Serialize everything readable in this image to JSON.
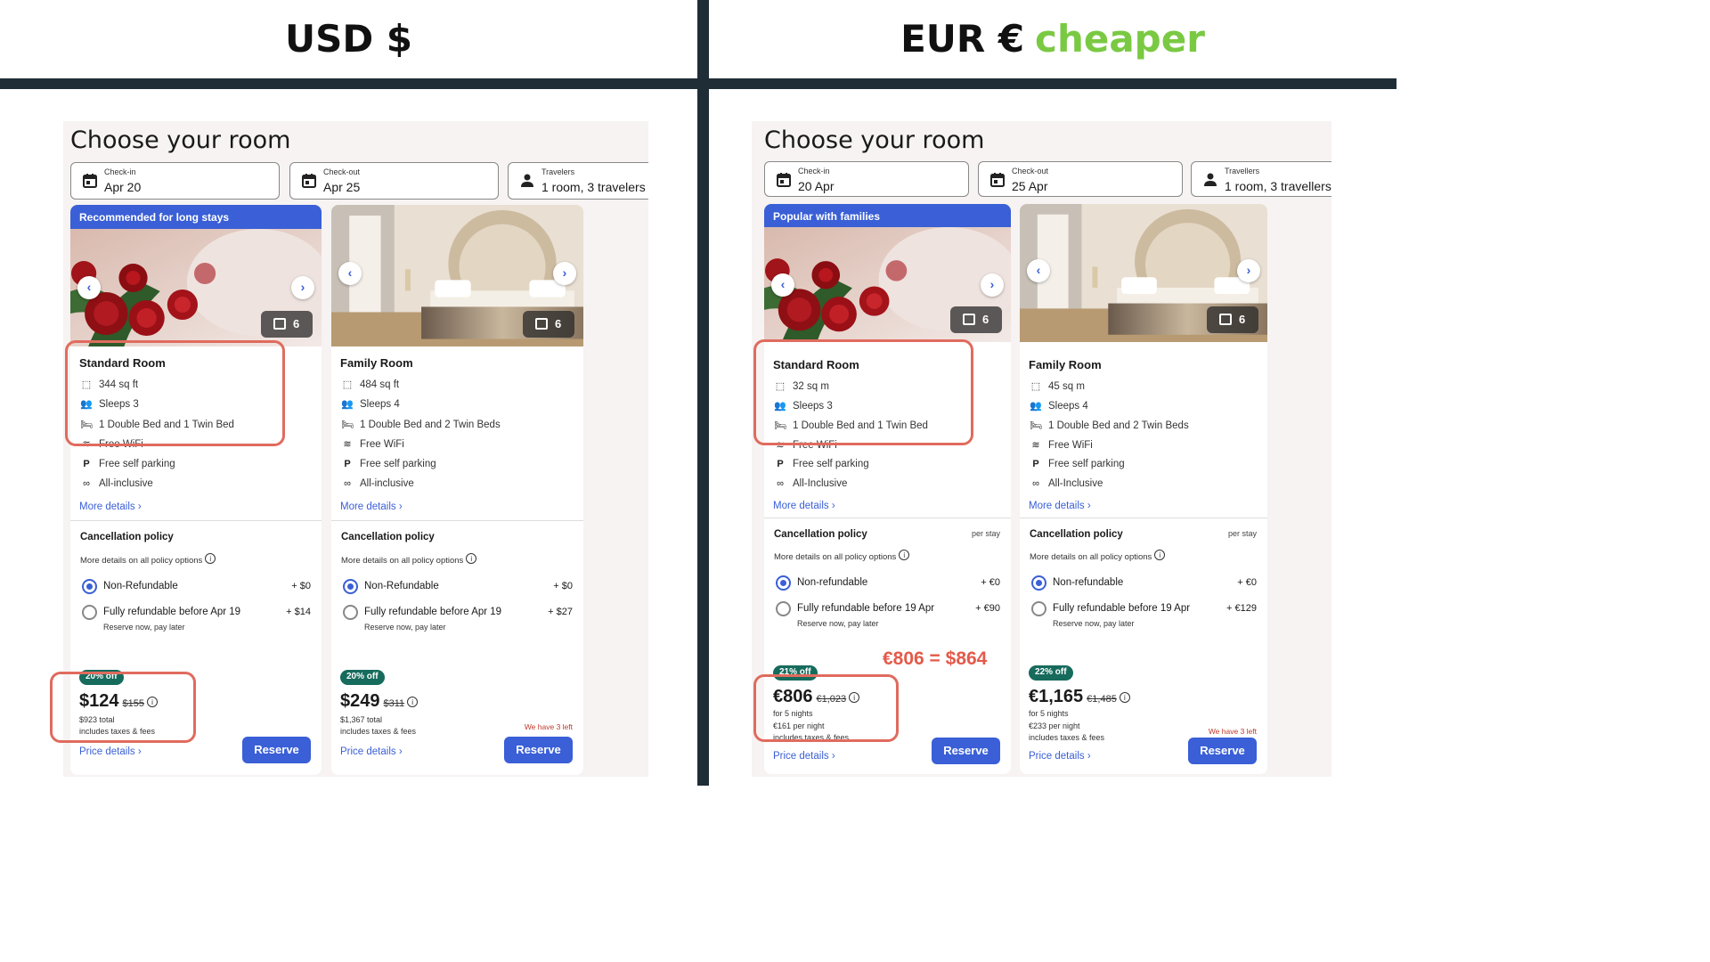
{
  "left": {
    "heading": "USD $",
    "title": "Choose your room",
    "checkin": {
      "label": "Check-in",
      "value": "Apr 20"
    },
    "checkout": {
      "label": "Check-out",
      "value": "Apr 25"
    },
    "travelers": {
      "label": "Travelers",
      "value": "1 room, 3 travelers"
    },
    "cards": [
      {
        "banner": "Recommended for long stays",
        "photo_count": "6",
        "name": "Standard Room",
        "amenities": [
          "344 sq ft",
          "Sleeps 3",
          "1 Double Bed and 1 Twin Bed",
          "Free WiFi",
          "Free self parking",
          "All-inclusive"
        ],
        "more_details": "More details",
        "cp_title": "Cancellation policy",
        "cp_sub": "More details on all policy options",
        "opt1": {
          "label": "Non-Refundable",
          "price": "+ $0"
        },
        "opt2": {
          "label": "Fully refundable before Apr 19",
          "price": "+ $14",
          "sub": "Reserve now, pay later"
        },
        "discount": "20% off",
        "price": "$124",
        "old_price": "$155",
        "lines": [
          "$923 total",
          "includes taxes & fees"
        ],
        "note": "",
        "price_details": "Price details",
        "reserve": "Reserve"
      },
      {
        "banner": "",
        "photo_count": "6",
        "name": "Family Room",
        "amenities": [
          "484 sq ft",
          "Sleeps 4",
          "1 Double Bed and 2 Twin Beds",
          "Free WiFi",
          "Free self parking",
          "All-inclusive"
        ],
        "more_details": "More details",
        "cp_title": "Cancellation policy",
        "cp_sub": "More details on all policy options",
        "opt1": {
          "label": "Non-Refundable",
          "price": "+ $0"
        },
        "opt2": {
          "label": "Fully refundable before Apr 19",
          "price": "+ $27",
          "sub": "Reserve now, pay later"
        },
        "discount": "20% off",
        "price": "$249",
        "old_price": "$311",
        "lines": [
          "$1,367 total",
          "includes taxes & fees"
        ],
        "note": "We have 3 left",
        "price_details": "Price details",
        "reserve": "Reserve"
      }
    ]
  },
  "right": {
    "heading": "EUR €",
    "heading_accent": "cheaper",
    "title": "Choose your room",
    "checkin": {
      "label": "Check-in",
      "value": "20 Apr"
    },
    "checkout": {
      "label": "Check-out",
      "value": "25 Apr"
    },
    "travelers": {
      "label": "Travellers",
      "value": "1 room, 3 travellers"
    },
    "equivalence": "€806 = $864",
    "cards": [
      {
        "banner": "Popular with families",
        "photo_count": "6",
        "name": "Standard Room",
        "amenities": [
          "32 sq m",
          "Sleeps 3",
          "1 Double Bed and 1 Twin Bed",
          "Free WiFi",
          "Free self parking",
          "All-Inclusive"
        ],
        "more_details": "More details",
        "cp_title": "Cancellation policy",
        "per_stay": "per stay",
        "cp_sub": "More details on all policy options",
        "opt1": {
          "label": "Non-refundable",
          "price": "+ €0"
        },
        "opt2": {
          "label": "Fully refundable before 19 Apr",
          "price": "+ €90",
          "sub": "Reserve now, pay later"
        },
        "discount": "21% off",
        "price": "€806",
        "old_price": "€1,023",
        "lines": [
          "for 5 nights",
          "€161 per night",
          "includes taxes & fees"
        ],
        "note": "",
        "price_details": "Price details",
        "reserve": "Reserve"
      },
      {
        "banner": "",
        "photo_count": "6",
        "name": "Family Room",
        "amenities": [
          "45 sq m",
          "Sleeps 4",
          "1 Double Bed and 2 Twin Beds",
          "Free WiFi",
          "Free self parking",
          "All-Inclusive"
        ],
        "more_details": "More details",
        "cp_title": "Cancellation policy",
        "per_stay": "per stay",
        "cp_sub": "More details on all policy options",
        "opt1": {
          "label": "Non-refundable",
          "price": "+ €0"
        },
        "opt2": {
          "label": "Fully refundable before 19 Apr",
          "price": "+ €129",
          "sub": "Reserve now, pay later"
        },
        "discount": "22% off",
        "price": "€1,165",
        "old_price": "€1,485",
        "lines": [
          "for 5 nights",
          "€233 per night",
          "includes taxes & fees"
        ],
        "note": "We have 3 left",
        "price_details": "Price details",
        "reserve": "Reserve"
      }
    ]
  },
  "colors": {
    "accent": "#3a5fd6",
    "discount": "#166b5c",
    "highlight": "#e06b5e",
    "cheaper": "#7ac943",
    "divider": "#1f2d36"
  },
  "icons": {
    "calendar": "calendar-icon",
    "person": "person-icon",
    "area": "floor-area-icon",
    "people": "people-icon",
    "bed": "bed-icon",
    "wifi": "wifi-icon",
    "parking": "parking-icon",
    "all_inclusive": "infinity-icon",
    "gallery": "gallery-icon",
    "chevron_left": "chevron-left-icon",
    "chevron_right": "chevron-right-icon",
    "info": "info-icon"
  }
}
